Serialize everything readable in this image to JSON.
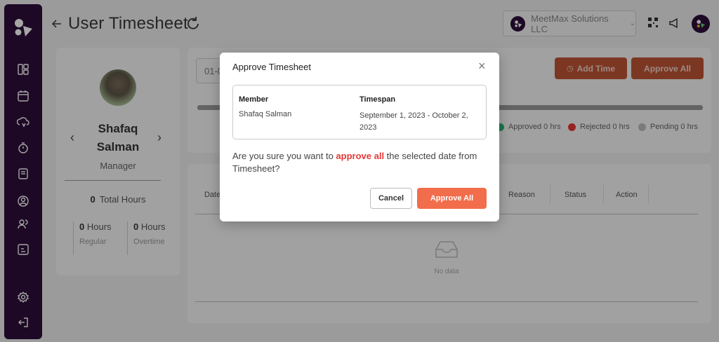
{
  "header": {
    "title": "User Timesheet",
    "organization": "MeetMax Solutions LLC"
  },
  "sidebar": {
    "items": [
      {
        "icon": "dashboard-icon"
      },
      {
        "icon": "calendar-icon"
      },
      {
        "icon": "cloud-sync-icon"
      },
      {
        "icon": "stopwatch-icon"
      },
      {
        "icon": "document-icon"
      },
      {
        "icon": "user-circle-icon"
      },
      {
        "icon": "users-icon"
      },
      {
        "icon": "report-icon"
      },
      {
        "icon": "settings-icon"
      },
      {
        "icon": "logout-icon"
      }
    ]
  },
  "profile": {
    "first_name": "Shafaq",
    "last_name": "Salman",
    "role": "Manager",
    "total_hours_value": "0",
    "total_hours_label": "Total Hours",
    "regular_value": "0",
    "regular_unit": "Hours",
    "regular_label": "Regular",
    "overtime_value": "0",
    "overtime_unit": "Hours",
    "overtime_label": "Overtime"
  },
  "top_panel": {
    "date_range_value": "01-0",
    "add_time_label": "Add Time",
    "approve_all_label": "Approve All",
    "legend": {
      "approved": "Approved 0 hrs",
      "rejected": "Rejected 0 hrs",
      "pending": "Pending 0 hrs"
    }
  },
  "table": {
    "columns": [
      "Date",
      "Reason",
      "Status",
      "Action"
    ],
    "empty_text": "No data"
  },
  "modal": {
    "title": "Approve Timesheet",
    "member_header": "Member",
    "timespan_header": "Timespan",
    "member_value": "Shafaq Salman",
    "timespan_value": "September 1, 2023 - October 2, 2023",
    "confirm_prefix": "Are you sure you want to ",
    "confirm_highlight": "approve all",
    "confirm_suffix": " the selected date from Timesheet?",
    "cancel_label": "Cancel",
    "approve_label": "Approve All"
  },
  "colors": {
    "sidebar": "#2d0e3a",
    "accent": "#f26d4b",
    "approved": "#2bb673",
    "rejected": "#e53935",
    "pending": "#bdbdbd"
  }
}
